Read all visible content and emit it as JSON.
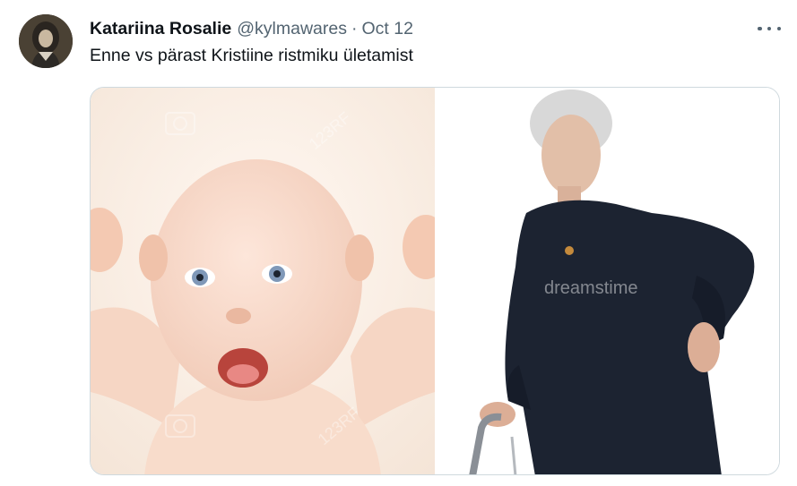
{
  "tweet": {
    "author_name": "Katariina Rosalie",
    "handle": "@kylmawares",
    "separator": "·",
    "date": "Oct 12",
    "text": "Enne vs pärast Kristiine ristmiku ületamist"
  },
  "media": {
    "images": [
      {
        "subject": "baby",
        "watermark_icon": "camera-icon",
        "watermark_text": "123RF"
      },
      {
        "subject": "elderly woman with walker",
        "watermark_text": "dreamstime"
      }
    ]
  },
  "icons": {
    "more": "more-horizontal-icon"
  },
  "colors": {
    "text_primary": "#0f1419",
    "text_secondary": "#536471",
    "border": "#cfd9de"
  }
}
